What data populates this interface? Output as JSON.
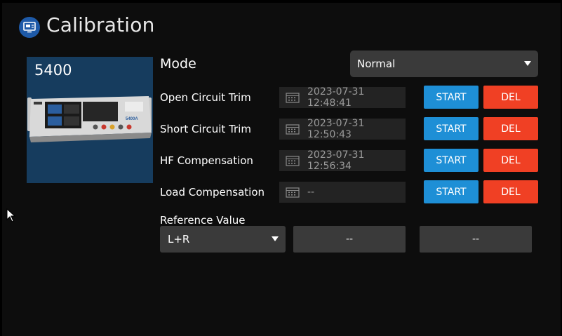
{
  "header": {
    "title": "Calibration",
    "icon": "calibration-icon"
  },
  "device": {
    "model": "5400",
    "front_label": "5400A"
  },
  "mode": {
    "label": "Mode",
    "selected": "Normal"
  },
  "calibrations": [
    {
      "label": "Open Circuit Trim",
      "timestamp": "2023-07-31 12:48:41",
      "start": "START",
      "del": "DEL"
    },
    {
      "label": "Short Circuit Trim",
      "timestamp": "2023-07-31 12:50:43",
      "start": "START",
      "del": "DEL"
    },
    {
      "label": "HF Compensation",
      "timestamp": "2023-07-31 12:56:34",
      "start": "START",
      "del": "DEL"
    },
    {
      "label": "Load Compensation",
      "timestamp": "--",
      "start": "START",
      "del": "DEL"
    }
  ],
  "reference": {
    "label": "Reference Value",
    "type_selected": "L+R",
    "value1": "--",
    "value2": "--"
  },
  "colors": {
    "start": "#1e8fd6",
    "del": "#f04024",
    "device_bg": "#163c5e",
    "header_icon": "#1e5aa8"
  }
}
